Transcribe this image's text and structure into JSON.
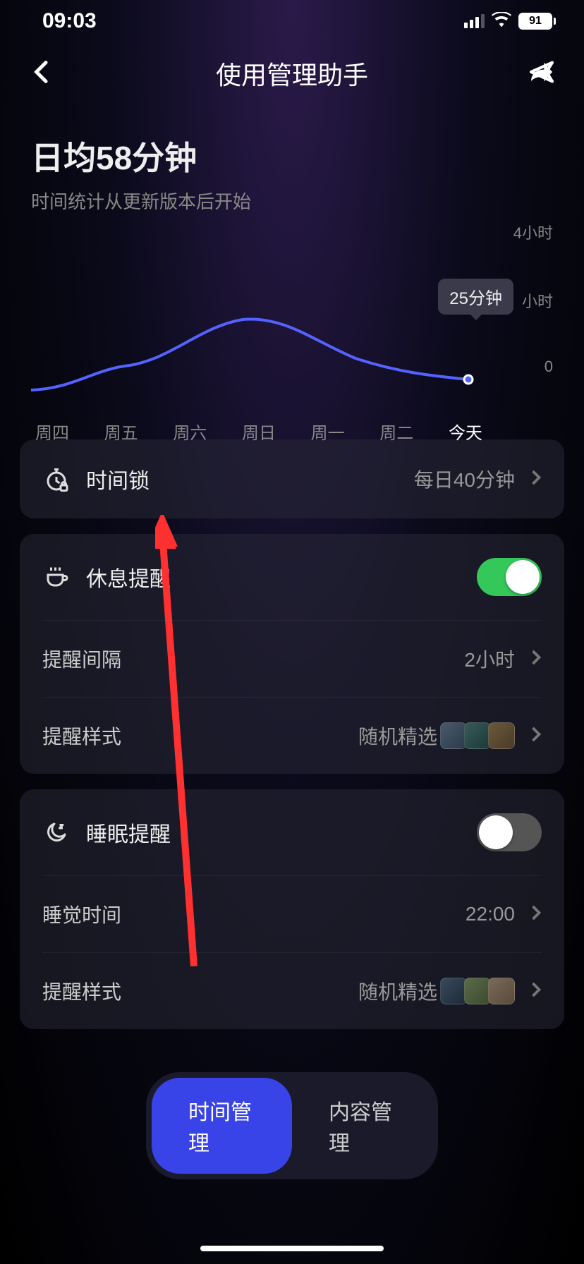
{
  "status": {
    "time": "09:03",
    "battery": "91"
  },
  "nav": {
    "title": "使用管理助手"
  },
  "summary": {
    "title": "日均58分钟",
    "subtitle": "时间统计从更新版本后开始"
  },
  "chart_data": {
    "type": "line",
    "categories": [
      "周四",
      "周五",
      "周六",
      "周日",
      "周一",
      "周二",
      "今天"
    ],
    "values": [
      15,
      40,
      95,
      110,
      70,
      50,
      25
    ],
    "ylim": [
      0,
      240
    ],
    "yticks": [
      "4小时",
      "小时",
      "0"
    ],
    "tooltip": "25分钟",
    "title": "",
    "xlabel": "",
    "ylabel": ""
  },
  "timelock": {
    "label": "时间锁",
    "value": "每日40分钟"
  },
  "rest": {
    "label": "休息提醒",
    "on": true,
    "interval": {
      "label": "提醒间隔",
      "value": "2小时"
    },
    "style": {
      "label": "提醒样式",
      "value": "随机精选"
    }
  },
  "sleep": {
    "label": "睡眠提醒",
    "on": false,
    "time": {
      "label": "睡觉时间",
      "value": "22:00"
    },
    "style": {
      "label": "提醒样式",
      "value": "随机精选"
    }
  },
  "tabs": {
    "time": "时间管理",
    "content": "内容管理"
  }
}
